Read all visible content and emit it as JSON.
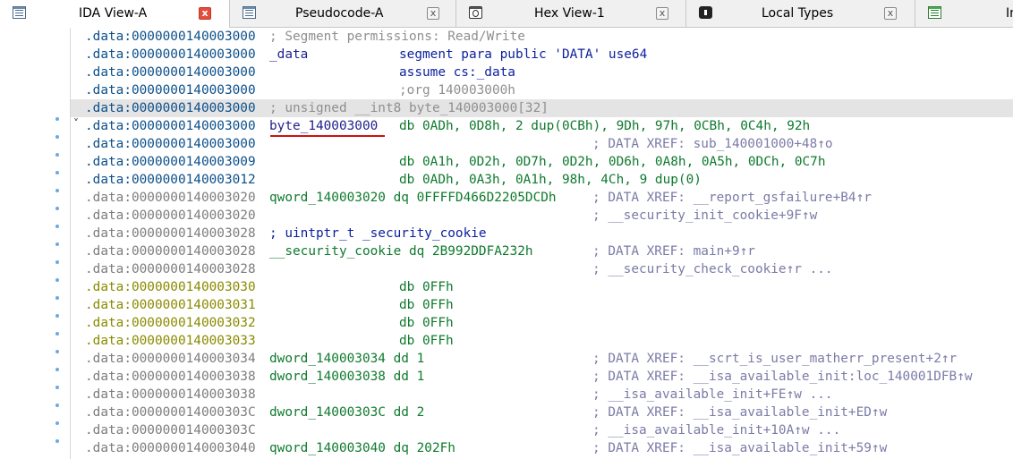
{
  "tabs": [
    {
      "label": "IDA View-A",
      "icon": "listing-icon",
      "close": "close-icon",
      "active": true
    },
    {
      "label": "Pseudocode-A",
      "icon": "listing-icon",
      "close": "close-icon",
      "active": false
    },
    {
      "label": "Hex View-1",
      "icon": "hex-view-icon",
      "close": "close-icon",
      "active": false
    },
    {
      "label": "Local Types",
      "icon": "local-types-icon",
      "close": "close-icon",
      "active": false
    },
    {
      "label": "Im",
      "icon": "imports-icon",
      "active": false
    }
  ],
  "close_glyph": "x",
  "lines": [
    {
      "addr": ".data:0000000140003000",
      "addr_style": "data",
      "c2": "; Segment permissions: Read/Write",
      "c2_style": "comment"
    },
    {
      "addr": ".data:0000000140003000",
      "addr_style": "data",
      "c2": "_data",
      "c2_style": "label",
      "c3": "segment para public 'DATA' use64",
      "c3_style": "kw"
    },
    {
      "addr": ".data:0000000140003000",
      "addr_style": "data",
      "c3": "assume cs:_data",
      "c3_style": "kw"
    },
    {
      "addr": ".data:0000000140003000",
      "addr_style": "data",
      "c3": ";org 140003000h",
      "c3_style": "comment"
    },
    {
      "addr": ".data:0000000140003000",
      "addr_style": "data",
      "c2": "; unsigned __int8 byte_140003000[32]",
      "c2_style": "comment",
      "highlight": true
    },
    {
      "addr": ".data:0000000140003000",
      "addr_style": "data",
      "c2": "byte_140003000",
      "c2_style": "label",
      "c3": "db 0ADh, 0D8h, 2 dup(0CBh), 9Dh, 97h, 0CBh, 0C4h, 92h",
      "c3_style": "num"
    },
    {
      "addr": ".data:0000000140003000",
      "addr_style": "data",
      "c4": "; DATA XREF: sub_140001000+48↑o",
      "c4_style": "xref"
    },
    {
      "addr": ".data:0000000140003009",
      "addr_style": "data",
      "c3": "db 0A1h, 0D2h, 0D7h, 0D2h, 0D6h, 0A8h, 0A5h, 0DCh, 0C7h",
      "c3_style": "num"
    },
    {
      "addr": ".data:0000000140003012",
      "addr_style": "data",
      "c3": "db 0ADh, 0A3h, 0A1h, 98h, 4Ch, 9 dup(0)",
      "c3_style": "num"
    },
    {
      "addr": ".data:0000000140003020",
      "addr_style": "gray",
      "c2": "qword_140003020 dq 0FFFFD466D2205DCDh",
      "c2_style": "num",
      "c4": "; DATA XREF: __report_gsfailure+B4↑r",
      "c4_style": "xref"
    },
    {
      "addr": ".data:0000000140003020",
      "addr_style": "gray",
      "c4": "; __security_init_cookie+9F↑w",
      "c4_style": "xref"
    },
    {
      "addr": ".data:0000000140003028",
      "addr_style": "gray",
      "c2": "; uintptr_t _security_cookie",
      "c2_style": "kw"
    },
    {
      "addr": ".data:0000000140003028",
      "addr_style": "gray",
      "c2": "__security_cookie dq 2B992DDFA232h",
      "c2_style": "num",
      "c4": "; DATA XREF: main+9↑r",
      "c4_style": "xref"
    },
    {
      "addr": ".data:0000000140003028",
      "addr_style": "gray",
      "c4": "; __security_check_cookie↑r ...",
      "c4_style": "xref"
    },
    {
      "addr": ".data:0000000140003030",
      "addr_style": "olive",
      "c3": "db 0FFh",
      "c3_style": "num"
    },
    {
      "addr": ".data:0000000140003031",
      "addr_style": "olive",
      "c3": "db 0FFh",
      "c3_style": "num"
    },
    {
      "addr": ".data:0000000140003032",
      "addr_style": "olive",
      "c3": "db 0FFh",
      "c3_style": "num"
    },
    {
      "addr": ".data:0000000140003033",
      "addr_style": "olive",
      "c3": "db 0FFh",
      "c3_style": "num"
    },
    {
      "addr": ".data:0000000140003034",
      "addr_style": "gray",
      "c2": "dword_140003034 dd 1",
      "c2_style": "num",
      "c4": "; DATA XREF: __scrt_is_user_matherr_present+2↑r",
      "c4_style": "xref"
    },
    {
      "addr": ".data:0000000140003038",
      "addr_style": "gray",
      "c2": "dword_140003038 dd 1",
      "c2_style": "num",
      "c4": "; DATA XREF: __isa_available_init:loc_140001DFB↑w",
      "c4_style": "xref"
    },
    {
      "addr": ".data:0000000140003038",
      "addr_style": "gray",
      "c4": "; __isa_available_init+FE↑w ...",
      "c4_style": "xref"
    },
    {
      "addr": ".data:000000014000303C",
      "addr_style": "gray",
      "c2": "dword_14000303C dd 2",
      "c2_style": "num",
      "c4": "; DATA XREF: __isa_available_init+ED↑w",
      "c4_style": "xref"
    },
    {
      "addr": ".data:000000014000303C",
      "addr_style": "gray",
      "c4": "; __isa_available_init+10A↑w ...",
      "c4_style": "xref"
    },
    {
      "addr": ".data:0000000140003040",
      "addr_style": "gray",
      "c2": "qword_140003040 dq 202Fh",
      "c2_style": "num",
      "c4": "; DATA XREF: __isa_available_init+59↑w",
      "c4_style": "xref"
    }
  ],
  "collapse_glyph": "˅",
  "colors": {
    "address": "#0b4f8a",
    "comment": "#8f8f8f",
    "number": "#0f7a2e",
    "xref": "#7b7ba8",
    "highlight": "#e4e4e4",
    "underline": "#d01010"
  }
}
